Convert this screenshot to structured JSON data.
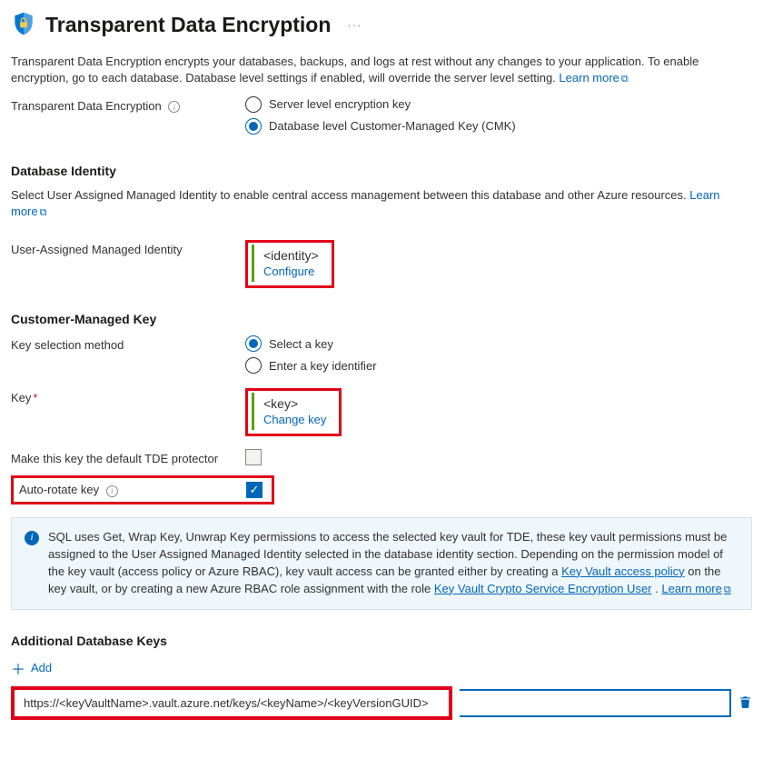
{
  "header": {
    "title": "Transparent Data Encryption"
  },
  "intro": {
    "text": "Transparent Data Encryption encrypts your databases, backups, and logs at rest without any changes to your application. To enable encryption, go to each database. Database level settings if enabled, will override the server level setting.",
    "learn_more": "Learn more"
  },
  "tde_radio": {
    "label": "Transparent Data Encryption",
    "options": [
      {
        "label": "Server level encryption key",
        "selected": false
      },
      {
        "label": "Database level Customer-Managed Key (CMK)",
        "selected": true
      }
    ]
  },
  "db_identity": {
    "heading": "Database Identity",
    "desc": "Select User Assigned Managed Identity to enable central access management between this database and other Azure resources.",
    "learn_more": "Learn more",
    "field_label": "User-Assigned Managed Identity",
    "value": "<identity>",
    "action": "Configure"
  },
  "cmk": {
    "heading": "Customer-Managed Key",
    "selection_label": "Key selection method",
    "selection_options": [
      {
        "label": "Select a key",
        "selected": true
      },
      {
        "label": "Enter a key identifier",
        "selected": false
      }
    ],
    "key_label": "Key",
    "key_value": "<key>",
    "key_action": "Change key",
    "default_protector_label": "Make this key the default TDE protector",
    "auto_rotate_label": "Auto-rotate key"
  },
  "info_box": {
    "text_pre": "SQL uses Get, Wrap Key, Unwrap Key permissions to access the selected key vault for TDE, these key vault permissions must be assigned to the User Assigned Managed Identity selected in the database identity section. Depending on the permission model of the key vault (access policy or Azure RBAC), key vault access can be granted either by creating a ",
    "link1": "Key Vault access policy",
    "text_mid": " on the key vault, or by creating a new Azure RBAC role assignment with the role ",
    "link2": "Key Vault Crypto Service Encryption User",
    "text_post": ". ",
    "learn_more": "Learn more"
  },
  "additional_keys": {
    "heading": "Additional Database Keys",
    "add_label": "Add",
    "url_value": "https://<keyVaultName>.vault.azure.net/keys/<keyName>/<keyVersionGUID>"
  }
}
